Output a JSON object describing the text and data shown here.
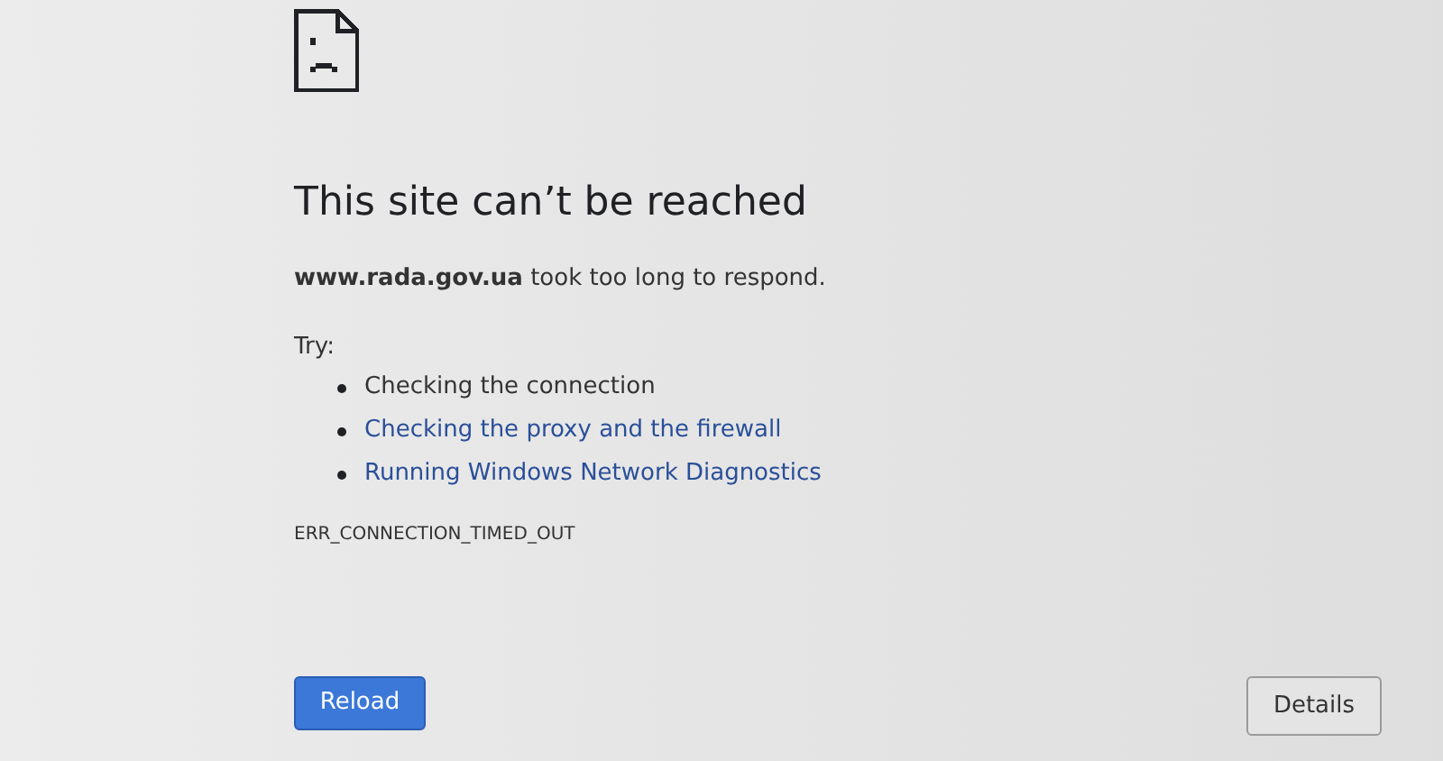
{
  "heading": "This site can’t be reached",
  "message": "**www.rada.gov.ua** took too long to respond.",
  "suggestions_label": "Try:",
  "suggestions": [
    {
      "text": "Checking the connection",
      "kind": "text"
    },
    {
      "text": "Checking the proxy and the firewall",
      "kind": "link"
    },
    {
      "text": "Running Windows Network Diagnostics",
      "kind": "link"
    }
  ],
  "error_code": "ERR_CONNECTION_TIMED_OUT",
  "buttons": [
    {
      "label": "Reload",
      "kind": "primary"
    },
    {
      "label": "Details",
      "kind": "secondary"
    }
  ]
}
